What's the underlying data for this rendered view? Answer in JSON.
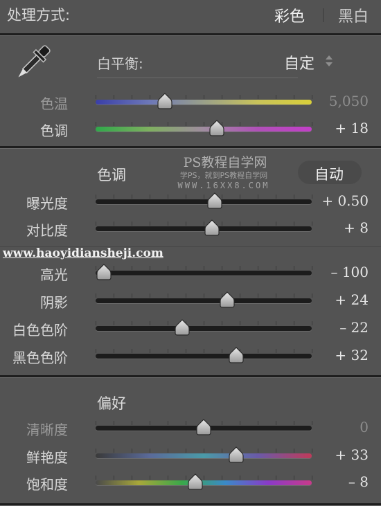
{
  "header": {
    "title": "处理方式:",
    "color_option": "彩色",
    "bw_option": "黑白"
  },
  "white_balance": {
    "label": "白平衡:",
    "value": "自定",
    "sliders": [
      {
        "id": "temp",
        "label": "色温",
        "value_text": "5,050",
        "position": 0.32,
        "track": "temp",
        "dim": true
      },
      {
        "id": "tint",
        "label": "色调",
        "value_text": "+ 18",
        "position": 0.56,
        "track": "tint",
        "dim": false
      }
    ]
  },
  "tone": {
    "title": "色调",
    "auto_label": "自动",
    "sliders_a": [
      {
        "id": "exposure",
        "label": "曝光度",
        "value_text": "+ 0.50",
        "position": 0.55,
        "track": "dark",
        "dim": false
      },
      {
        "id": "contrast",
        "label": "对比度",
        "value_text": "+ 8",
        "position": 0.54,
        "track": "dark",
        "dim": false
      }
    ],
    "sliders_b": [
      {
        "id": "highlights",
        "label": "高光",
        "value_text": "– 100",
        "position": 0.04,
        "track": "dark",
        "dim": false
      },
      {
        "id": "shadows",
        "label": "阴影",
        "value_text": "+ 24",
        "position": 0.61,
        "track": "dark",
        "dim": false
      },
      {
        "id": "whites",
        "label": "白色色阶",
        "value_text": "– 22",
        "position": 0.4,
        "track": "dark",
        "dim": false
      },
      {
        "id": "blacks",
        "label": "黑色色阶",
        "value_text": "+ 32",
        "position": 0.65,
        "track": "dark",
        "dim": false
      }
    ]
  },
  "presence": {
    "title": "偏好",
    "sliders": [
      {
        "id": "clarity",
        "label": "清晰度",
        "value_text": "0",
        "position": 0.5,
        "track": "dark",
        "dim": true
      },
      {
        "id": "vibrance",
        "label": "鲜艳度",
        "value_text": "+ 33",
        "position": 0.65,
        "track": "vib",
        "dim": false
      },
      {
        "id": "saturation",
        "label": "饱和度",
        "value_text": "– 8",
        "position": 0.46,
        "track": "sat",
        "dim": false
      }
    ]
  },
  "watermarks": {
    "ps_title": "PS教程自学网",
    "ps_sub": "学PS，就到PS教程自学网",
    "ps_url": "WWW.16XX8.COM",
    "site_url": "www.haoyidiansheji.com"
  },
  "colors": {
    "panel_bg": "#535353",
    "track_dark": "#1c1c1c",
    "accent_text": "#d8d8d8"
  },
  "icons": {
    "eyedropper": "eyedropper-icon",
    "updown": "updown-arrows-icon"
  }
}
